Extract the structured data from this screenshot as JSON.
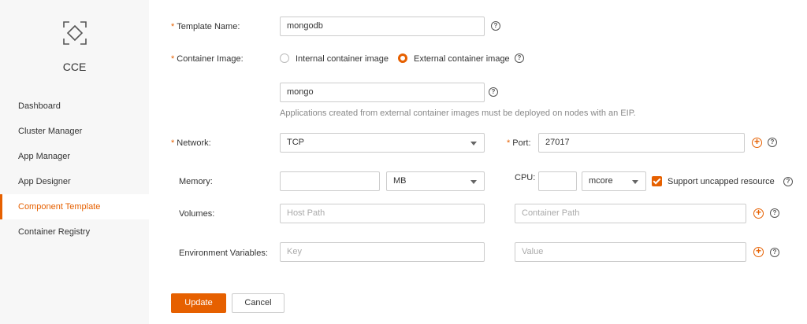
{
  "sidebar": {
    "app_name": "CCE",
    "items": [
      {
        "label": "Dashboard"
      },
      {
        "label": "Cluster Manager"
      },
      {
        "label": "App Manager"
      },
      {
        "label": "App Designer"
      },
      {
        "label": "Component Template",
        "active": true
      },
      {
        "label": "Container Registry"
      }
    ]
  },
  "form": {
    "template_name": {
      "label": "Template Name:",
      "value": "mongodb"
    },
    "container_image": {
      "label": "Container Image:",
      "options": [
        "Internal container image",
        "External container image"
      ],
      "selected": "External container image",
      "value": "mongo",
      "hint": "Applications created from external container images must be deployed on nodes with an EIP."
    },
    "network": {
      "label": "Network:",
      "value": "TCP"
    },
    "port": {
      "label": "Port:",
      "value": "27017"
    },
    "memory": {
      "label": "Memory:",
      "value": "",
      "unit": "MB"
    },
    "cpu": {
      "label": "CPU:",
      "value": "",
      "unit": "mcore",
      "uncapped_label": "Support uncapped resource",
      "uncapped_checked": true
    },
    "volumes": {
      "label": "Volumes:",
      "host_placeholder": "Host Path",
      "container_placeholder": "Container Path"
    },
    "env": {
      "label": "Environment Variables:",
      "key_placeholder": "Key",
      "value_placeholder": "Value"
    }
  },
  "actions": {
    "update_label": "Update",
    "cancel_label": "Cancel"
  },
  "colors": {
    "accent": "#e66000",
    "sidebar_bg": "#f7f7f7"
  },
  "icons": {
    "logo": "cce-logo-icon",
    "help": "help-icon",
    "add": "add-icon",
    "caret": "chevron-down-icon"
  }
}
